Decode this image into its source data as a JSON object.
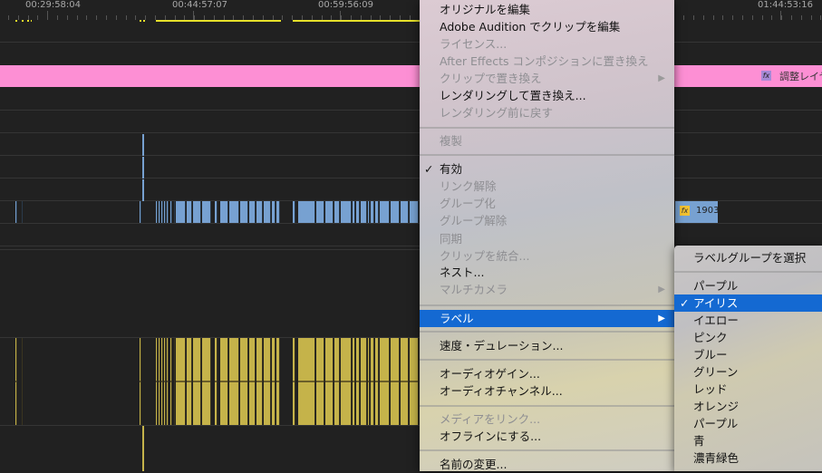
{
  "timeline": {
    "timecodes": [
      "00:29:58:04",
      "00:44:57:07",
      "00:59:56:09",
      "01:44:53:16"
    ],
    "adjustment_layer_label": "調整レイヤー",
    "clip_label": "1903",
    "fx_badge": "fx",
    "colors": {
      "adjustment": "#fd8fd4",
      "video": "#77a1d1",
      "audio": "#c5b34a",
      "work_area": "#e6e02a"
    }
  },
  "context_menu": {
    "items": [
      {
        "label": "オリジナルを編集",
        "enabled": true
      },
      {
        "label": "Adobe Audition でクリップを編集",
        "enabled": true
      },
      {
        "label": "ライセンス...",
        "enabled": false
      },
      {
        "label": "After Effects コンポジションに置き換え",
        "enabled": false
      },
      {
        "label": "クリップで置き換え",
        "enabled": false,
        "submenu": true
      },
      {
        "label": "レンダリングして置き換え...",
        "enabled": true
      },
      {
        "label": "レンダリング前に戻す",
        "enabled": false
      },
      {
        "label": "複製",
        "enabled": false
      },
      {
        "label": "有効",
        "enabled": true,
        "checked": true
      },
      {
        "label": "リンク解除",
        "enabled": false
      },
      {
        "label": "グループ化",
        "enabled": false
      },
      {
        "label": "グループ解除",
        "enabled": false
      },
      {
        "label": "同期",
        "enabled": false
      },
      {
        "label": "クリップを統合...",
        "enabled": false
      },
      {
        "label": "ネスト...",
        "enabled": true
      },
      {
        "label": "マルチカメラ",
        "enabled": false,
        "submenu": true
      },
      {
        "label": "ラベル",
        "enabled": true,
        "submenu": true,
        "highlighted": true
      },
      {
        "label": "速度・デュレーション...",
        "enabled": true
      },
      {
        "label": "オーディオゲイン...",
        "enabled": true
      },
      {
        "label": "オーディオチャンネル...",
        "enabled": true
      },
      {
        "label": "メディアをリンク...",
        "enabled": false
      },
      {
        "label": "オフラインにする...",
        "enabled": true
      },
      {
        "label": "名前の変更...",
        "enabled": true
      }
    ],
    "check_glyph": "✓",
    "submenu_arrow": "▶"
  },
  "label_submenu": {
    "header": "ラベルグループを選択",
    "items": [
      "パープル",
      "アイリス",
      "イエロー",
      "ピンク",
      "ブルー",
      "グリーン",
      "レッド",
      "オレンジ",
      "パープル",
      "青",
      "濃青緑色"
    ],
    "selected": "アイリス"
  }
}
